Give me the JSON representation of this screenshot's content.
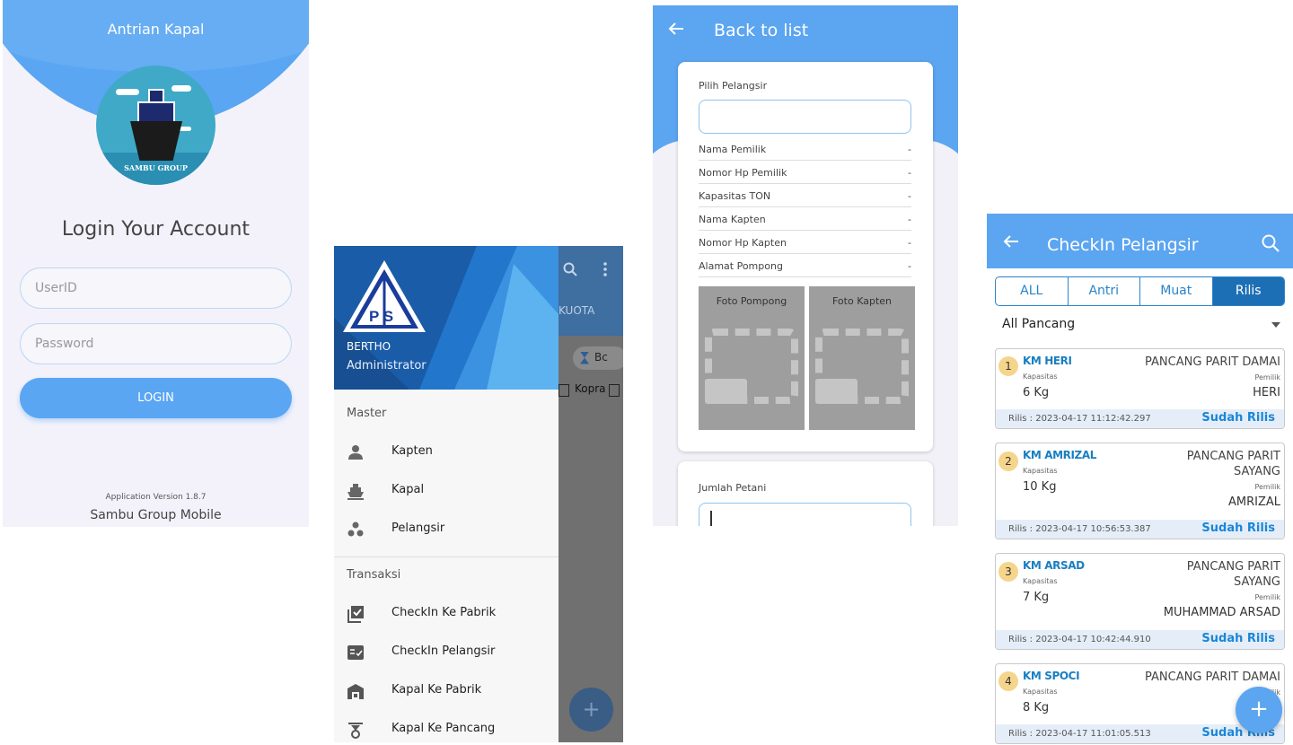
{
  "login": {
    "app_title": "Antrian Kapal",
    "logo_text": "SAMBU GROUP",
    "headline": "Login Your Account",
    "userid_placeholder": "UserID",
    "password_placeholder": "Password",
    "login_label": "LOGIN",
    "version": "Application Version 1.8.7",
    "app_name": "Sambu Group Mobile"
  },
  "drawer": {
    "logo_text": "P S",
    "user": "BERTHO",
    "role": "Administrator",
    "sections": [
      {
        "title": "Master",
        "items": [
          {
            "label": "Kapten",
            "icon": "person-icon"
          },
          {
            "label": "Kapal",
            "icon": "ship-icon"
          },
          {
            "label": "Pelangsir",
            "icon": "group-icon"
          }
        ]
      },
      {
        "title": "Transaksi",
        "items": [
          {
            "label": "CheckIn Ke Pabrik",
            "icon": "checklist-icon"
          },
          {
            "label": "CheckIn Pelangsir",
            "icon": "fact-check-icon"
          },
          {
            "label": "Kapal Ke Pabrik",
            "icon": "warehouse-icon"
          },
          {
            "label": "Kapal Ke Pancang",
            "icon": "scale-icon"
          }
        ]
      }
    ],
    "behind": {
      "tab": "KUOTA",
      "chip": "Bc",
      "checkbox_label": "Kopra",
      "fab": "+"
    }
  },
  "form": {
    "back_label": "Back to list",
    "pilih_label": "Pilih Pelangsir",
    "rows": [
      {
        "key": "Nama Pemilik",
        "value": "-"
      },
      {
        "key": "Nomor Hp Pemilik",
        "value": "-"
      },
      {
        "key": "Kapasitas TON",
        "value": "-"
      },
      {
        "key": "Nama Kapten",
        "value": "-"
      },
      {
        "key": "Nomor Hp Kapten",
        "value": "-"
      },
      {
        "key": "Alamat Pompong",
        "value": "-"
      }
    ],
    "photo_pompong": "Foto Pompong",
    "photo_kapten": "Foto Kapten",
    "jumlah_label": "Jumlah Petani"
  },
  "checkin": {
    "title": "CheckIn Pelangsir",
    "tabs": [
      "ALL",
      "Antri",
      "Muat",
      "Rilis"
    ],
    "active_tab": "Rilis",
    "filter": "All Pancang",
    "kapasitas_label": "Kapasitas",
    "pemilik_label": "Pemilik",
    "items": [
      {
        "no": "1",
        "ship": "KM HERI",
        "kapasitas": "6 Kg",
        "pancang": "PANCANG PARIT DAMAI",
        "pemilik": "HERI",
        "rilis": "Rilis : 2023-04-17 11:12:42.297",
        "status": "Sudah Rilis"
      },
      {
        "no": "2",
        "ship": "KM AMRIZAL",
        "kapasitas": "10 Kg",
        "pancang": "PANCANG PARIT SAYANG",
        "pemilik": "AMRIZAL",
        "rilis": "Rilis : 2023-04-17 10:56:53.387",
        "status": "Sudah Rilis"
      },
      {
        "no": "3",
        "ship": "KM ARSAD",
        "kapasitas": "7 Kg",
        "pancang": "PANCANG PARIT SAYANG",
        "pemilik": "MUHAMMAD ARSAD",
        "rilis": "Rilis : 2023-04-17 10:42:44.910",
        "status": "Sudah Rilis"
      },
      {
        "no": "4",
        "ship": "KM SPOCI",
        "kapasitas": "8 Kg",
        "pancang": "PANCANG PARIT DAMAI",
        "pemilik": "",
        "rilis": "Rilis : 2023-04-17 11:01:05.513",
        "status": "Sudah Rilis"
      }
    ],
    "fab": "+"
  }
}
